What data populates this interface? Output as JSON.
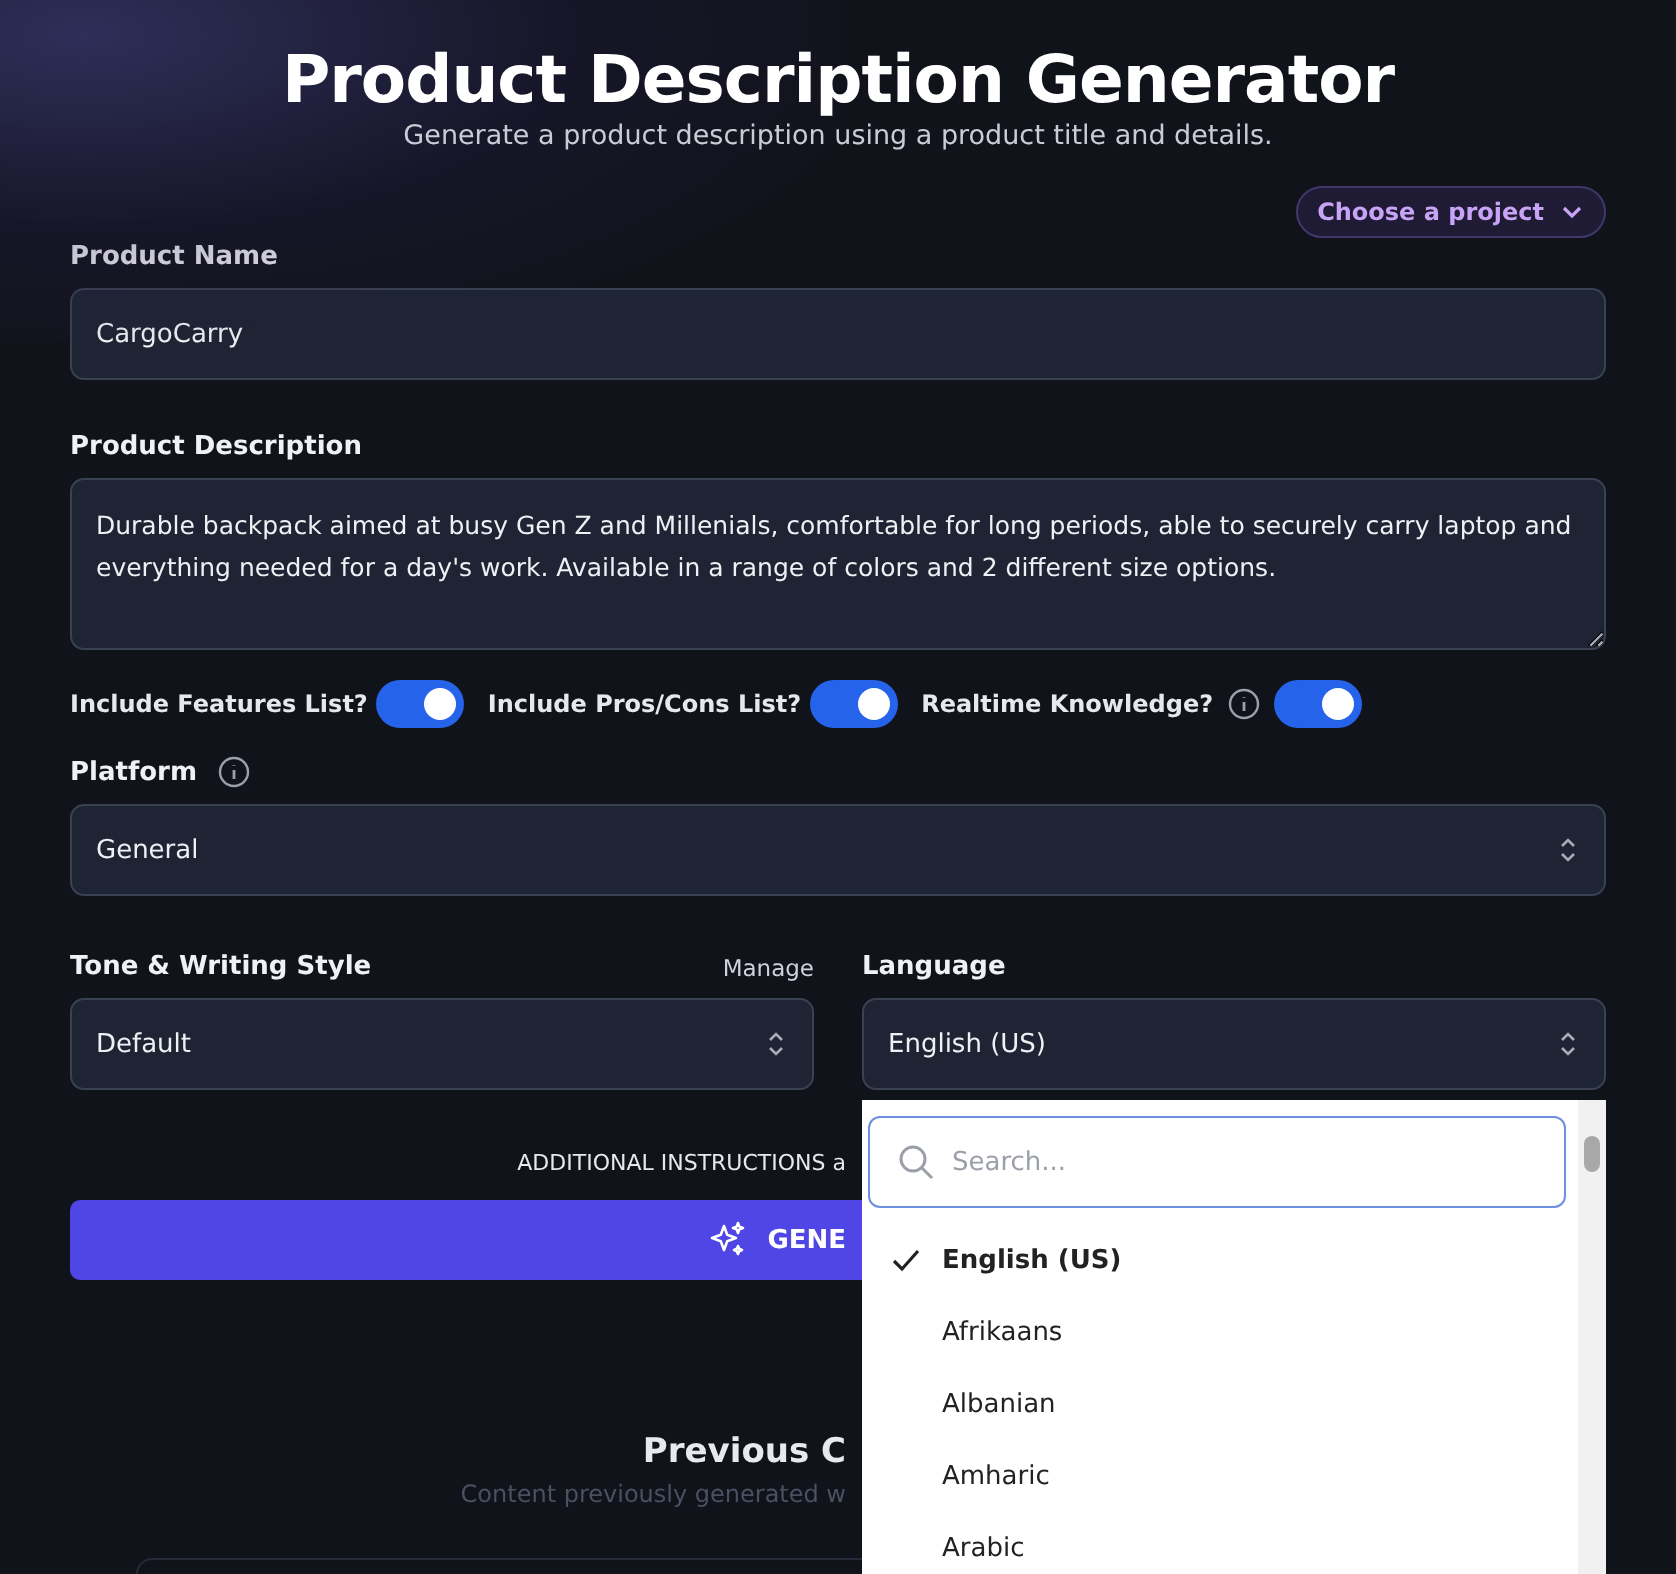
{
  "header": {
    "title": "Product Description Generator",
    "subtitle": "Generate a product description using a product title and details.",
    "project_button": "Choose a project"
  },
  "product_name": {
    "label": "Product Name",
    "value": "CargoCarry"
  },
  "product_description": {
    "label": "Product Description",
    "value": "Durable backpack aimed at busy Gen Z and Millenials, comfortable for long periods, able to securely carry laptop and everything needed for a day's work. Available in a range of colors and 2 different size options."
  },
  "toggles": [
    {
      "label": "Include Features List?",
      "info": false,
      "on": true
    },
    {
      "label": "Include Pros/Cons List?",
      "info": false,
      "on": true
    },
    {
      "label": "Realtime Knowledge?",
      "info": true,
      "on": true
    }
  ],
  "platform": {
    "label": "Platform",
    "value": "General"
  },
  "tone": {
    "label": "Tone & Writing Style",
    "link": "Manage",
    "value": "Default"
  },
  "language": {
    "label": "Language",
    "value": "English (US)"
  },
  "additional_instructions": "ADDITIONAL INSTRUCTIONS a",
  "generate_button": "GENE",
  "previous": {
    "title": "Previous C",
    "subtitle": "Content previously generated w"
  },
  "dropdown": {
    "search_placeholder": "Search...",
    "options": [
      {
        "label": "English (US)",
        "selected": true
      },
      {
        "label": "Afrikaans",
        "selected": false
      },
      {
        "label": "Albanian",
        "selected": false
      },
      {
        "label": "Amharic",
        "selected": false
      },
      {
        "label": "Arabic",
        "selected": false
      }
    ]
  }
}
